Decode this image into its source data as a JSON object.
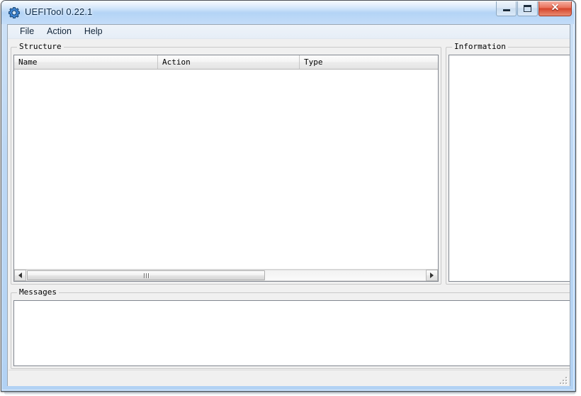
{
  "window": {
    "title": "UEFITool 0.22.1",
    "app_icon": "gear-icon",
    "caption": {
      "minimize_label": "–",
      "maximize_label": "□",
      "close_label": "✕"
    }
  },
  "menubar": {
    "items": [
      {
        "label": "File"
      },
      {
        "label": "Action"
      },
      {
        "label": "Help"
      }
    ]
  },
  "structure": {
    "group_title": "Structure",
    "columns": [
      {
        "label": "Name"
      },
      {
        "label": "Action"
      },
      {
        "label": "Type"
      }
    ],
    "rows": [],
    "hscroll": {
      "left_arrow": "scroll-left-icon",
      "right_arrow": "scroll-right-icon",
      "grip": "scrollbar-grip"
    }
  },
  "information": {
    "group_title": "Information",
    "content": ""
  },
  "messages": {
    "group_title": "Messages",
    "content": ""
  },
  "statusbar": {
    "text": "",
    "grip": "resize-grip"
  },
  "colors": {
    "titlebar_accent": "#b9d7f6",
    "close_button": "#d5452c",
    "client_background": "#f0f0f0",
    "panel_background": "#ffffff",
    "border": "#828790"
  }
}
